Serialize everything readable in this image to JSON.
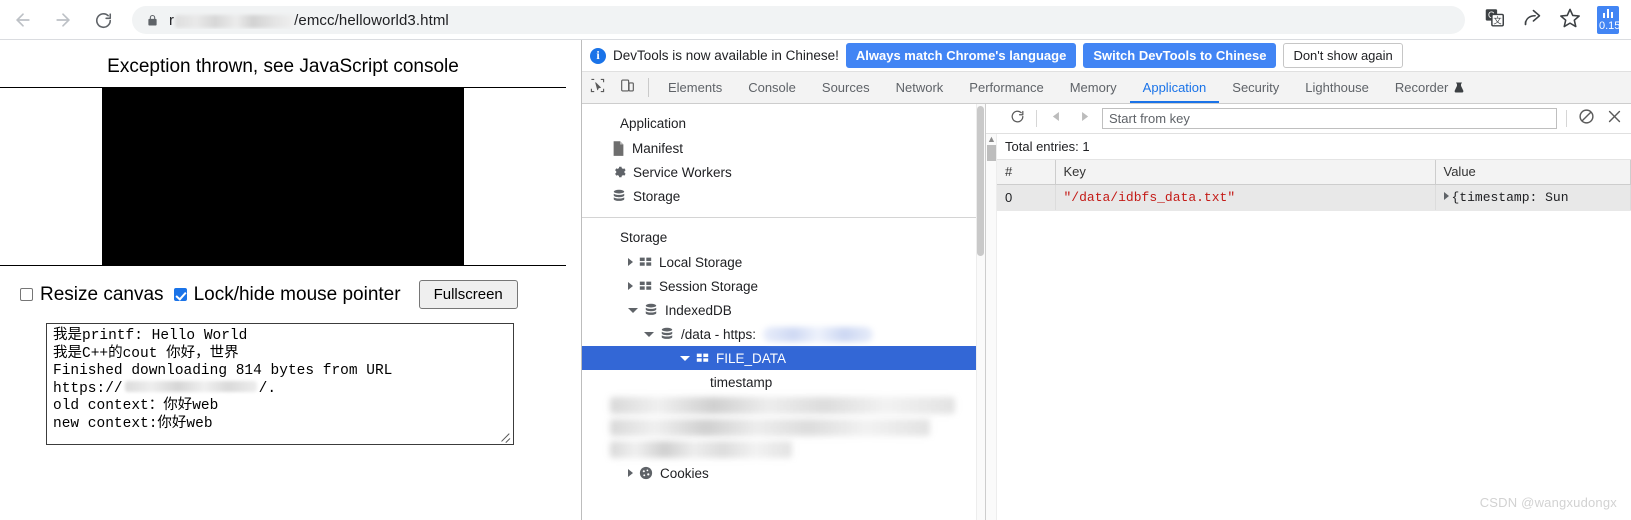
{
  "browser": {
    "back_icon": "arrow-left-icon",
    "forward_icon": "arrow-right-icon",
    "reload_icon": "reload-icon",
    "lock_icon": "lock-icon",
    "url_prefix": "r",
    "url_suffix": "/emcc/helloworld3.html",
    "translate_icon": "translate-icon",
    "share_icon": "share-icon",
    "bookmark_icon": "star-icon",
    "extension_value": "0.15"
  },
  "page": {
    "status_text": "Exception thrown, see JavaScript console",
    "resize_canvas_label": "Resize canvas",
    "resize_canvas_checked": false,
    "lock_pointer_label": "Lock/hide mouse pointer",
    "lock_pointer_checked": true,
    "fullscreen_label": "Fullscreen",
    "output_line1": "我是printf: Hello World",
    "output_line2": "我是C++的cout 你好，世界",
    "output_line3": "Finished downloading 814 bytes from URL",
    "output_line4_prefix": "https://",
    "output_line4_suffix": "/.",
    "output_line5": "old context：你好web",
    "output_line6": "new context:你好web"
  },
  "devtools": {
    "infobar": {
      "message": "DevTools is now available in Chinese!",
      "btn_always_match": "Always match Chrome's language",
      "btn_switch": "Switch DevTools to Chinese",
      "btn_dont_show": "Don't show again"
    },
    "inspect_icon": "inspect-element-icon",
    "device_icon": "device-toolbar-icon",
    "tabs": [
      {
        "label": "Elements",
        "active": false
      },
      {
        "label": "Console",
        "active": false
      },
      {
        "label": "Sources",
        "active": false
      },
      {
        "label": "Network",
        "active": false
      },
      {
        "label": "Performance",
        "active": false
      },
      {
        "label": "Memory",
        "active": false
      },
      {
        "label": "Application",
        "active": true
      },
      {
        "label": "Security",
        "active": false
      },
      {
        "label": "Lighthouse",
        "active": false
      },
      {
        "label": "Recorder",
        "active": false
      }
    ],
    "sidebar": {
      "application_header": "Application",
      "application_items": [
        {
          "label": "Manifest",
          "icon": "manifest-file-icon"
        },
        {
          "label": "Service Workers",
          "icon": "gear-icon"
        },
        {
          "label": "Storage",
          "icon": "database-icon"
        }
      ],
      "storage_header": "Storage",
      "local_storage": "Local Storage",
      "session_storage": "Session Storage",
      "indexeddb": "IndexedDB",
      "db_label_prefix": "/data - https:",
      "object_store": "FILE_DATA",
      "index_timestamp": "timestamp",
      "cookies": "Cookies"
    },
    "idb_panel": {
      "refresh_icon": "refresh-icon",
      "prev_icon": "triangle-left-icon",
      "next_icon": "triangle-right-icon",
      "key_placeholder": "Start from key",
      "clear_icon": "clear-objectstore-icon",
      "close_icon": "close-icon",
      "total_entries": "Total entries: 1",
      "columns": [
        "#",
        "Key",
        "Value"
      ],
      "rows": [
        {
          "index": "0",
          "key": "\"/data/idbfs_data.txt\"",
          "value": "{timestamp: Sun"
        }
      ]
    }
  },
  "watermark": "CSDN @wangxudongx"
}
